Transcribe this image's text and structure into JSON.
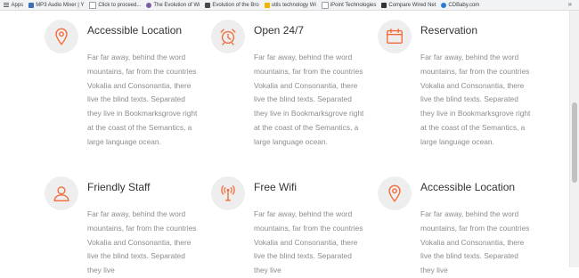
{
  "bookmarks": {
    "items": [
      {
        "label": "Apps",
        "color": "#5f6368"
      },
      {
        "label": "MP3 Audio Mixer | Y",
        "color": "#3b6fb6"
      },
      {
        "label": "Click to proceed...",
        "color": "#9aa0a6"
      },
      {
        "label": "The Evolution of Wi",
        "color": "#7b5ea7"
      },
      {
        "label": "Evolution of the Bro",
        "color": "#4a4a4a"
      },
      {
        "label": "utils technology Wi",
        "color": "#f4b400"
      },
      {
        "label": "iPoint Technologies",
        "color": "#9aa0a6"
      },
      {
        "label": "Compare Wired Net",
        "color": "#333333"
      },
      {
        "label": "CDBaby.com",
        "color": "#2b7bd6"
      }
    ],
    "more": "»"
  },
  "accent_color": "#f26b3a",
  "features": [
    {
      "title": "Accessible Location",
      "icon": "location-pin-icon",
      "text": "Far far away, behind the word mountains, far from the countries Vokalia and Consonantia, there live the blind texts. Separated they live in Bookmarksgrove right at the coast of the Semantics, a large language ocean."
    },
    {
      "title": "Open 24/7",
      "icon": "alarm-clock-icon",
      "text": "Far far away, behind the word mountains, far from the countries Vokalia and Consonantia, there live the blind texts. Separated they live in Bookmarksgrove right at the coast of the Semantics, a large language ocean."
    },
    {
      "title": "Reservation",
      "icon": "calendar-icon",
      "text": "Far far away, behind the word mountains, far from the countries Vokalia and Consonantia, there live the blind texts. Separated they live in Bookmarksgrove right at the coast of the Semantics, a large language ocean."
    },
    {
      "title": "Friendly Staff",
      "icon": "person-icon",
      "text": "Far far away, behind the word mountains, far from the countries Vokalia and Consonantia, there live the blind texts. Separated they live"
    },
    {
      "title": "Free Wifi",
      "icon": "wifi-antenna-icon",
      "text": "Far far away, behind the word mountains, far from the countries Vokalia and Consonantia, there live the blind texts. Separated they live"
    },
    {
      "title": "Accessible Location",
      "icon": "location-pin-icon",
      "text": "Far far away, behind the word mountains, far from the countries Vokalia and Consonantia, there live the blind texts. Separated they live"
    }
  ]
}
